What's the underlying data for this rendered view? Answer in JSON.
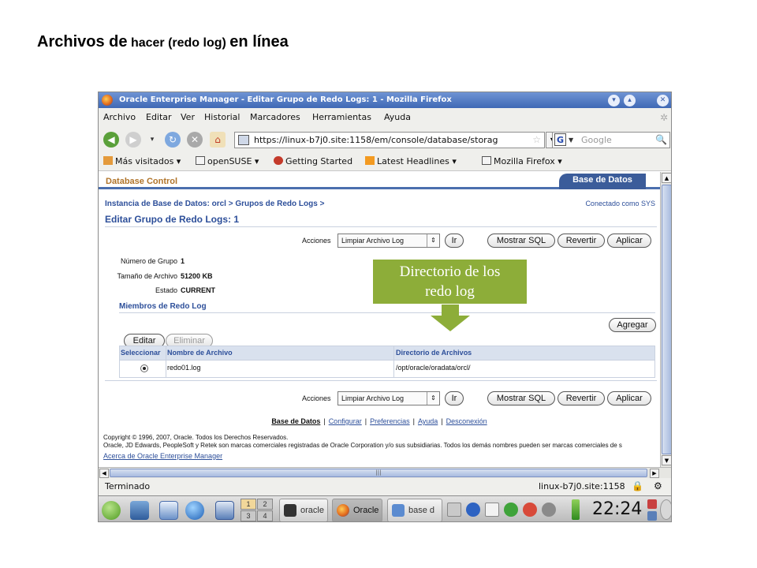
{
  "slide": {
    "title_part1": "Archivos de",
    "title_part2": "hacer (redo log)",
    "title_part3": "en línea"
  },
  "window": {
    "title": "Oracle Enterprise Manager - Editar Grupo de Redo Logs: 1 - Mozilla Firefox"
  },
  "menubar": {
    "items": [
      "Archivo",
      "Editar",
      "Ver",
      "Historial",
      "Marcadores",
      "Herramientas",
      "Ayuda"
    ]
  },
  "navbar": {
    "url": "https://linux-b7j0.site:1158/em/console/database/storag",
    "search_placeholder": "Google"
  },
  "bookmarks": {
    "items": [
      "Más visitados ▾",
      "openSUSE ▾",
      "Getting Started",
      "Latest Headlines ▾",
      "Mozilla Firefox ▾"
    ]
  },
  "em": {
    "header_left": "Database Control",
    "header_tab": "Base de Datos",
    "breadcrumb": "Instancia de Base de Datos: orcl  >  Grupos de Redo Logs  >",
    "connected": "Conectado como SYS",
    "page_title": "Editar Grupo de Redo Logs: 1",
    "actions_label": "Acciones",
    "actions_selected": "Limpiar Archivo Log",
    "btn_go": "Ir",
    "btn_show_sql": "Mostrar SQL",
    "btn_revert": "Revertir",
    "btn_apply": "Aplicar",
    "info": {
      "group_label": "Número de Grupo",
      "group_value": "1",
      "size_label": "Tamaño de Archivo",
      "size_value": "51200 KB",
      "state_label": "Estado",
      "state_value": "CURRENT"
    },
    "members_title": "Miembros de Redo Log",
    "btn_add": "Agregar",
    "btn_edit": "Editar",
    "btn_delete": "Eliminar",
    "table": {
      "headers": [
        "Seleccionar",
        "Nombre de Archivo",
        "Directorio de Archivos"
      ],
      "rows": [
        {
          "name": "redo01.log",
          "dir": "/opt/oracle/oradata/orcl/"
        }
      ]
    },
    "footer": {
      "current": "Base de Datos",
      "links": [
        "Configurar",
        "Preferencias",
        "Ayuda",
        "Desconexión"
      ]
    },
    "copyright_line1": "Copyright © 1996, 2007, Oracle. Todos los Derechos Reservados.",
    "copyright_line2": "Oracle, JD Edwards, PeopleSoft y Retek son marcas comerciales registradas de Oracle Corporation y/o sus subsidiarias. Todos los demás nombres pueden ser marcas comerciales de s",
    "about": "Acerca de Oracle Enterprise Manager"
  },
  "statusbar": {
    "status": "Terminado",
    "host": "linux-b7j0.site:1158"
  },
  "taskbar": {
    "pager": [
      "1",
      "2",
      "3",
      "4"
    ],
    "tasks": [
      "oracle",
      "Oracle",
      "base d"
    ],
    "clock": "22:24"
  },
  "callout": {
    "line1": "Directorio de los",
    "line2": "redo log",
    "color": "#8dad39"
  }
}
